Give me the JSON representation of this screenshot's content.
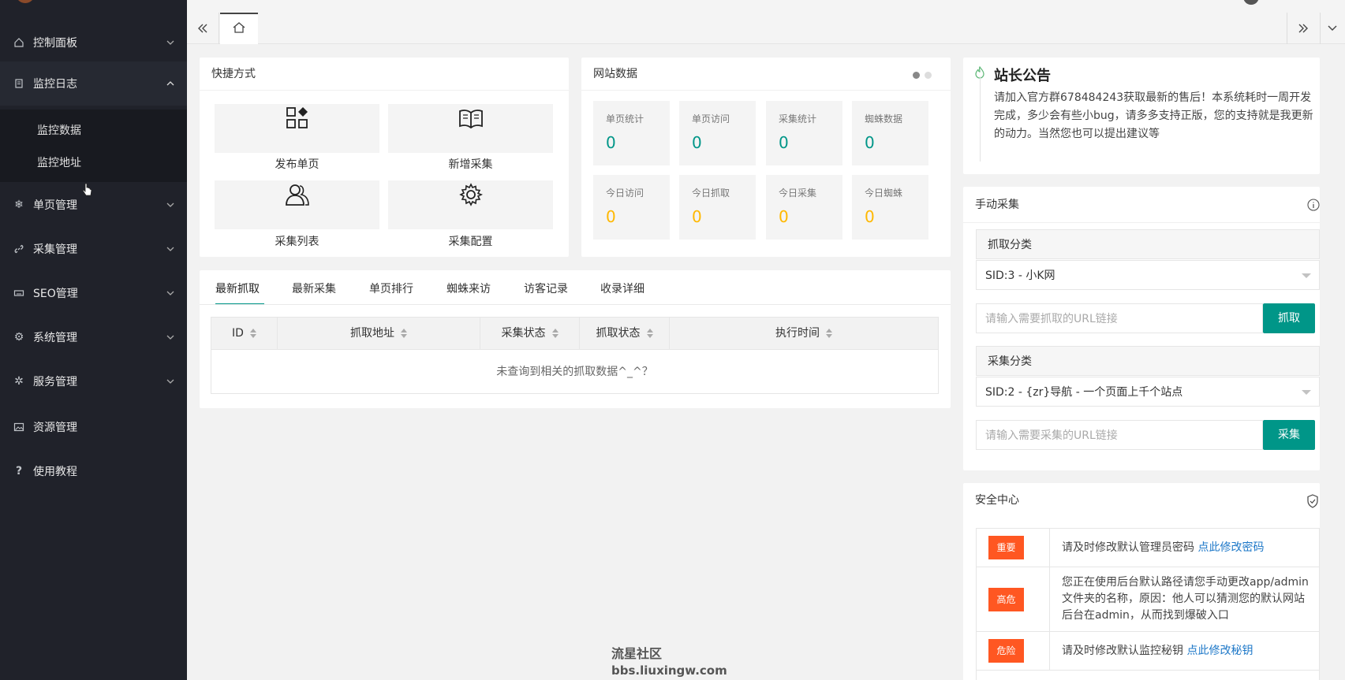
{
  "sidebar": {
    "items": [
      {
        "label": "控制面板",
        "icon": "home-icon"
      },
      {
        "label": "监控日志",
        "icon": "document-icon"
      },
      {
        "label": "单页管理",
        "icon": "snowflake-icon"
      },
      {
        "label": "采集管理",
        "icon": "link-icon"
      },
      {
        "label": "SEO管理",
        "icon": "keyboard-icon"
      },
      {
        "label": "系统管理",
        "icon": "gear-icon"
      },
      {
        "label": "服务管理",
        "icon": "service-icon"
      },
      {
        "label": "资源管理",
        "icon": "picture-icon"
      },
      {
        "label": "使用教程",
        "icon": "question-icon"
      }
    ],
    "sub_items": [
      "监控数据",
      "监控地址"
    ]
  },
  "quick": {
    "title": "快捷方式",
    "items": [
      {
        "label": "发布单页",
        "icon": "apps-icon"
      },
      {
        "label": "新增采集",
        "icon": "book-icon"
      },
      {
        "label": "采集列表",
        "icon": "users-icon"
      },
      {
        "label": "采集配置",
        "icon": "gear-icon"
      }
    ]
  },
  "site_data": {
    "title": "网站数据",
    "stats": [
      {
        "label": "单页统计",
        "value": "0"
      },
      {
        "label": "单页访问",
        "value": "0"
      },
      {
        "label": "采集统计",
        "value": "0"
      },
      {
        "label": "蜘蛛数据",
        "value": "0"
      },
      {
        "label": "今日访问",
        "value": "0"
      },
      {
        "label": "今日抓取",
        "value": "0"
      },
      {
        "label": "今日采集",
        "value": "0"
      },
      {
        "label": "今日蜘蛛",
        "value": "0"
      }
    ],
    "colors": {
      "top": "#009688",
      "bottom": "#ffb800"
    }
  },
  "tabs": [
    "最新抓取",
    "最新采集",
    "单页排行",
    "蜘蛛来访",
    "访客记录",
    "收录详细"
  ],
  "table": {
    "headers": [
      "ID",
      "抓取地址",
      "采集状态",
      "抓取状态",
      "执行时间"
    ],
    "empty": "未查询到相关的抓取数据^_^？"
  },
  "notice": {
    "title": "站长公告",
    "body": "请加入官方群678484243获取最新的售后！本系统耗时一周开发完成，多少会有些小bug，请多多支持正版，您的支持就是我更新的动力。当然您也可以提出建议等"
  },
  "manual": {
    "title": "手动采集",
    "fetch_label": "抓取分类",
    "fetch_select": "SID:3 - 小K网",
    "fetch_placeholder": "请输入需要抓取的URL链接",
    "fetch_button": "抓取",
    "collect_label": "采集分类",
    "collect_select": "SID:2 - {zr}导航 - 一个页面上千个站点",
    "collect_placeholder": "请输入需要采集的URL链接",
    "collect_button": "采集"
  },
  "security": {
    "title": "安全中心",
    "rows": [
      {
        "tag": "重要",
        "text": "请及时修改默认管理员密码",
        "link": "点此修改密码"
      },
      {
        "tag": "高危",
        "text": "您正在使用后台默认路径请您手动更改app/admin文件夹的名称，原因：他人可以猜测您的默认网站后台在admin，从而找到爆破入口",
        "link": ""
      },
      {
        "tag": "危险",
        "text": "请及时修改默认监控秘钥",
        "link": "点此修改秘钥"
      }
    ],
    "tag_color": "#ff5722"
  },
  "watermark": {
    "line1": "流星社区",
    "line2": "bbs.liuxingw.com"
  }
}
